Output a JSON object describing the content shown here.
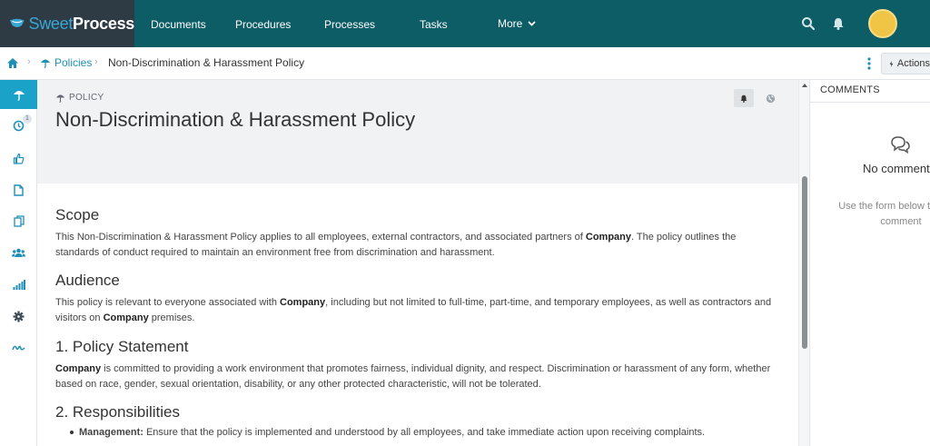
{
  "brand": {
    "sweet": "Sweet",
    "process": "Process"
  },
  "nav": {
    "items": [
      "Documents",
      "Procedures",
      "Processes",
      "Tasks"
    ],
    "more": "More"
  },
  "breadcrumb": {
    "section": "Policies",
    "current": "Non-Discrimination & Harassment Policy"
  },
  "toolbar": {
    "actions_label": "Actions"
  },
  "rail": {
    "items": [
      "umbrella-icon",
      "clock-icon",
      "thumbs-up-icon",
      "document-icon",
      "copy-icon",
      "users-icon",
      "signal-bars-icon",
      "gear-icon",
      "signature-icon"
    ],
    "clock_badge": "1"
  },
  "document": {
    "kind": "POLICY",
    "title": "Non-Discrimination & Harassment Policy",
    "sections": {
      "scope": {
        "heading": "Scope",
        "before": "This Non-Discrimination & Harassment Policy applies to all employees, external contractors, and associated partners of ",
        "company": "Company",
        "after": ". The policy outlines the standards of conduct required to maintain an environment free from discrimination and harassment."
      },
      "audience": {
        "heading": "Audience",
        "before": "This policy is relevant to everyone associated with ",
        "company": "Company",
        "middle": ", including but not limited to full-time, part-time, and temporary employees, as well as contractors and visitors on ",
        "company2": "Company",
        "after": " premises."
      },
      "statement": {
        "heading": "1. Policy Statement",
        "company": "Company",
        "after": " is committed to providing a work environment that promotes fairness, individual dignity, and respect. Discrimination or harassment of any form, whether based on race, gender, sexual orientation, disability, or any other protected characteristic, will not be tolerated."
      },
      "responsibilities": {
        "heading": "2. Responsibilities",
        "bullet_label": "Management:",
        "bullet_text": " Ensure that the policy is implemented and understood by all employees, and take immediate action upon receiving complaints."
      }
    }
  },
  "comments": {
    "title": "COMMENTS",
    "empty": "No comments",
    "hint": "Use the form below to add a comment"
  },
  "colors": {
    "nav_bg": "#0d5d67",
    "logo_bg": "#2e3b45",
    "accent": "#1aa2c9",
    "link": "#1f8fb8",
    "header_bg": "#f1f2f3"
  }
}
